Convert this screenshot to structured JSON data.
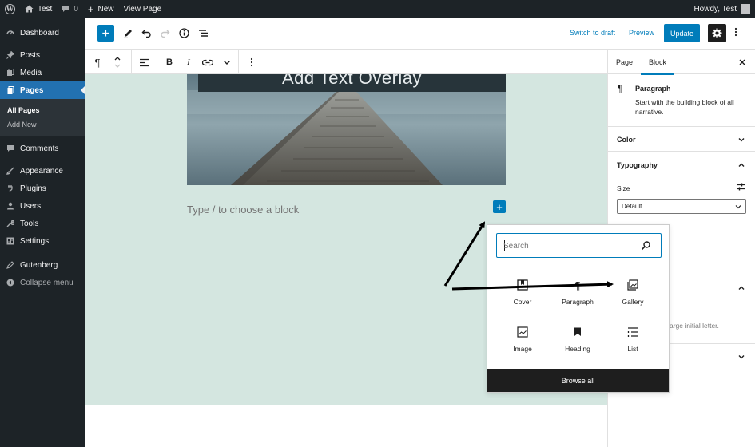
{
  "adminbar": {
    "site_name": "Test",
    "comments_count": "0",
    "new_label": "New",
    "view_page_label": "View Page",
    "howdy": "Howdy, Test"
  },
  "sidebar": {
    "dashboard": "Dashboard",
    "posts": "Posts",
    "media": "Media",
    "pages": "Pages",
    "submenu": {
      "all_pages": "All Pages",
      "add_new": "Add New"
    },
    "comments": "Comments",
    "appearance": "Appearance",
    "plugins": "Plugins",
    "users": "Users",
    "tools": "Tools",
    "settings": "Settings",
    "gutenberg": "Gutenberg",
    "collapse": "Collapse menu"
  },
  "topbar": {
    "switch_to_draft": "Switch to draft",
    "preview": "Preview",
    "update": "Update"
  },
  "canvas": {
    "heading": "Add Text Overlay",
    "placeholder": "Type / to choose a block"
  },
  "inserter": {
    "search_placeholder": "Search",
    "blocks": [
      {
        "label": "Cover",
        "icon": "cover-icon"
      },
      {
        "label": "Paragraph",
        "icon": "paragraph-icon"
      },
      {
        "label": "Gallery",
        "icon": "gallery-icon"
      },
      {
        "label": "Image",
        "icon": "image-icon"
      },
      {
        "label": "Heading",
        "icon": "heading-icon"
      },
      {
        "label": "List",
        "icon": "list-icon"
      }
    ],
    "browse_all": "Browse all"
  },
  "settings_panel": {
    "tab_page": "Page",
    "tab_block": "Block",
    "block_title": "Paragraph",
    "block_description": "Start with the building block of all narrative.",
    "color_title": "Color",
    "typography_title": "Typography",
    "size_label": "Size",
    "size_value": "Default",
    "partial_text": "arge initial letter."
  },
  "colors": {
    "admin_dark": "#1d2327",
    "accent": "#007cba",
    "canvas_bg": "#d4e6e0"
  }
}
